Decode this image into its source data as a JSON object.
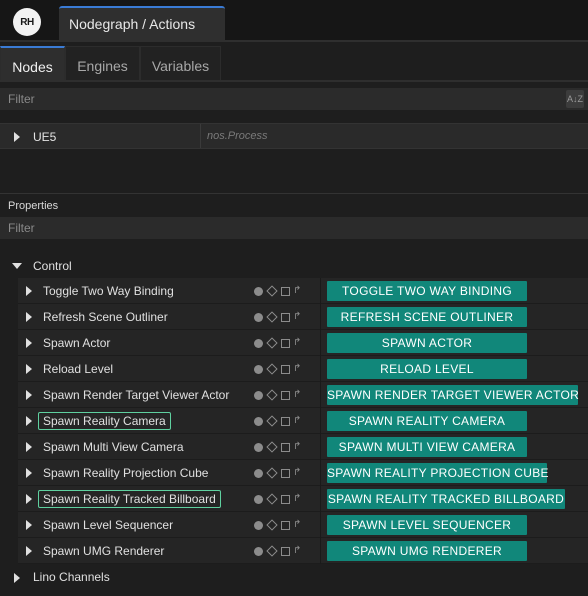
{
  "app": {
    "logo_text": "RH",
    "window_tab": "Nodegraph / Actions"
  },
  "tabs": [
    {
      "label": "Nodes",
      "active": true
    },
    {
      "label": "Engines",
      "active": false
    },
    {
      "label": "Variables",
      "active": false
    }
  ],
  "nodes_filter": {
    "placeholder": "Filter",
    "sort_icon": "sort-az-icon"
  },
  "node": {
    "name": "UE5",
    "type": "nos.Process"
  },
  "properties": {
    "header": "Properties",
    "filter_placeholder": "Filter",
    "group": "Control",
    "items": [
      {
        "label": "Toggle Two Way Binding",
        "button": "TOGGLE TWO WAY BINDING",
        "selected": false
      },
      {
        "label": "Refresh Scene Outliner",
        "button": "REFRESH SCENE OUTLINER",
        "selected": false
      },
      {
        "label": "Spawn Actor",
        "button": "SPAWN ACTOR",
        "selected": false
      },
      {
        "label": "Reload Level",
        "button": "RELOAD LEVEL",
        "selected": false
      },
      {
        "label": "Spawn Render Target Viewer Actor",
        "button": "SPAWN RENDER TARGET VIEWER ACTOR",
        "selected": false
      },
      {
        "label": "Spawn Reality Camera",
        "button": "SPAWN REALITY CAMERA",
        "selected": true
      },
      {
        "label": "Spawn Multi View Camera",
        "button": "SPAWN MULTI VIEW CAMERA",
        "selected": false
      },
      {
        "label": "Spawn Reality Projection Cube",
        "button": "SPAWN REALITY PROJECTION CUBE",
        "selected": false
      },
      {
        "label": "Spawn Reality Tracked Billboard",
        "button": "SPAWN REALITY TRACKED BILLBOARD",
        "selected": true
      },
      {
        "label": "Spawn Level Sequencer",
        "button": "SPAWN LEVEL SEQUENCER",
        "selected": false
      },
      {
        "label": "Spawn UMG Renderer",
        "button": "SPAWN UMG RENDERER",
        "selected": false
      }
    ],
    "next_group": "Lino Channels"
  },
  "colors": {
    "accent": "#3a7bd5",
    "button": "#11877a",
    "selected_outline": "#5fd1a0"
  }
}
